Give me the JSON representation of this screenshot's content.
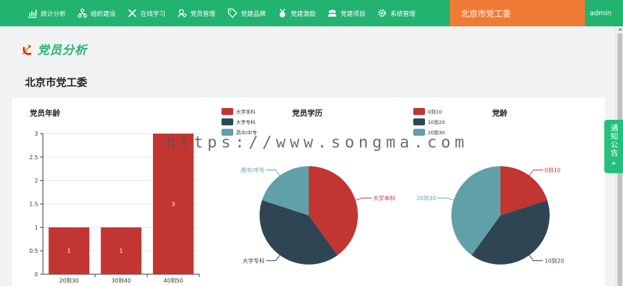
{
  "nav": [
    {
      "label": "统计分析",
      "icon": "bar-chart-icon"
    },
    {
      "label": "组织建设",
      "icon": "org-tree-icon"
    },
    {
      "label": "在线学习",
      "icon": "tools-icon"
    },
    {
      "label": "党员管理",
      "icon": "member-icon"
    },
    {
      "label": "党建品牌",
      "icon": "tag-icon"
    },
    {
      "label": "党建激励",
      "icon": "medal-icon"
    },
    {
      "label": "党建项目",
      "icon": "group-icon"
    },
    {
      "label": "系统管理",
      "icon": "gear-icon"
    }
  ],
  "org_selector": "北京市党工委",
  "user": "admin",
  "page_title": "党员分析",
  "org_heading": "北京市党工委",
  "notice_tab": "通知公告",
  "watermark": "https://www.songma.com",
  "colors": {
    "green": "#22b36f",
    "orange": "#f07b36",
    "red": "#c23531",
    "dark": "#2f4554",
    "teal": "#61a0a8"
  },
  "chart_data": [
    {
      "type": "bar",
      "title": "党员年龄",
      "categories": [
        "20到30",
        "30到40",
        "40到50"
      ],
      "values": [
        1,
        1,
        3
      ],
      "ylim": [
        0,
        3
      ],
      "yticks": [
        "0",
        "0.5",
        "1",
        "1.5",
        "2",
        "2.5",
        "3"
      ],
      "data_labels": [
        "1",
        "1",
        "3"
      ]
    },
    {
      "type": "pie",
      "title": "党员学历",
      "legend": [
        "大学本科",
        "大学专科",
        "高中/中专"
      ],
      "slices": [
        {
          "name": "大学本科",
          "value": 2
        },
        {
          "name": "大学专科",
          "value": 2
        },
        {
          "name": "高中/中专",
          "value": 1
        }
      ]
    },
    {
      "type": "pie",
      "title": "党龄",
      "legend": [
        "0到10",
        "10到20",
        "20到30"
      ],
      "slices": [
        {
          "name": "0到10",
          "value": 1
        },
        {
          "name": "10到20",
          "value": 2
        },
        {
          "name": "20到30",
          "value": 2
        }
      ]
    }
  ]
}
